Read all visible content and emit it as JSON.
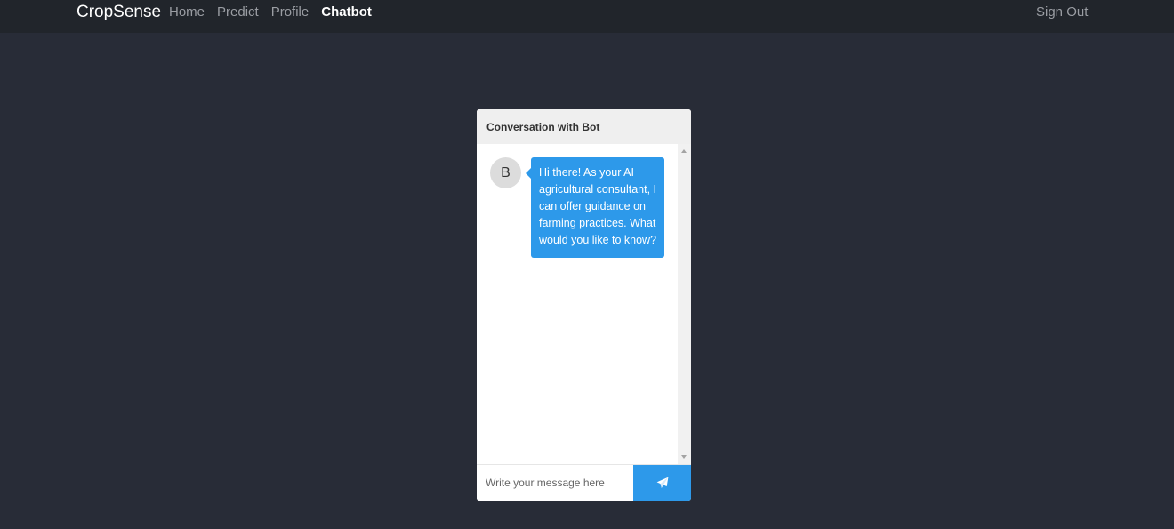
{
  "navbar": {
    "brand": "CropSense",
    "links": [
      {
        "label": "Home"
      },
      {
        "label": "Predict"
      },
      {
        "label": "Profile"
      },
      {
        "label": "Chatbot"
      }
    ],
    "active": "Chatbot",
    "sign_out": "Sign Out"
  },
  "chat": {
    "header": "Conversation with Bot",
    "messages": [
      {
        "sender_initial": "B",
        "text": "Hi there! As your AI agricultural consultant, I can offer guidance on farming practices. What would you like to know?"
      }
    ],
    "input_placeholder": "Write your message here",
    "send_icon": "paper-plane-icon"
  },
  "colors": {
    "background": "#282c37",
    "navbar": "#21252b",
    "accent": "#2d99ea"
  }
}
